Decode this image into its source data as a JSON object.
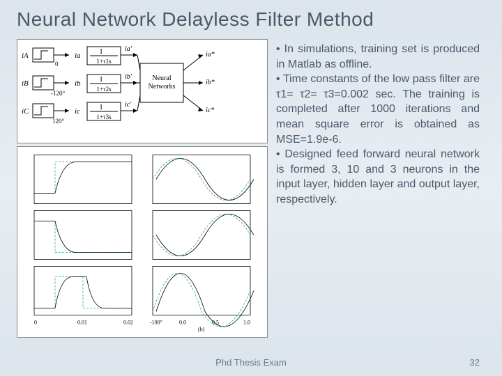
{
  "title": "Neural Network Delayless Filter Method",
  "bullet1": "• In simulations, training set is produced in Matlab as offline.",
  "bullet2": "• Time constants of the low pass filter are τ1= τ2= τ3=0.002 sec. The training is completed after 1000 iterations and mean square error is obtained as MSE=1.9e-6.",
  "bullet3": "• Designed feed forward neural network is formed 3, 10 and 3 neurons in the input layer, hidden layer and output layer, respectively.",
  "diagram": {
    "inputs": [
      "iA",
      "iB",
      "iC"
    ],
    "phases": [
      "0",
      "-120°",
      "120°"
    ],
    "tf1": "1",
    "tf1d": "1+τ1s",
    "tf2": "1",
    "tf2d": "1+τ2s",
    "tf3": "1",
    "tf3d": "1+τ3s",
    "mid": [
      "ia",
      "ib",
      "ic"
    ],
    "midp": [
      "ia'",
      "ib'",
      "ic'"
    ],
    "nn": "Neural Networks",
    "out": [
      "ia*",
      "ib*",
      "ic*"
    ]
  },
  "plots": {
    "x1": [
      "0",
      "0.01",
      "0.02"
    ],
    "x2": [
      "-100°",
      "0.0",
      "0.5",
      "1.0"
    ],
    "yb": "(b)"
  },
  "footer": {
    "center": "Phd Thesis Exam",
    "page": "32"
  }
}
